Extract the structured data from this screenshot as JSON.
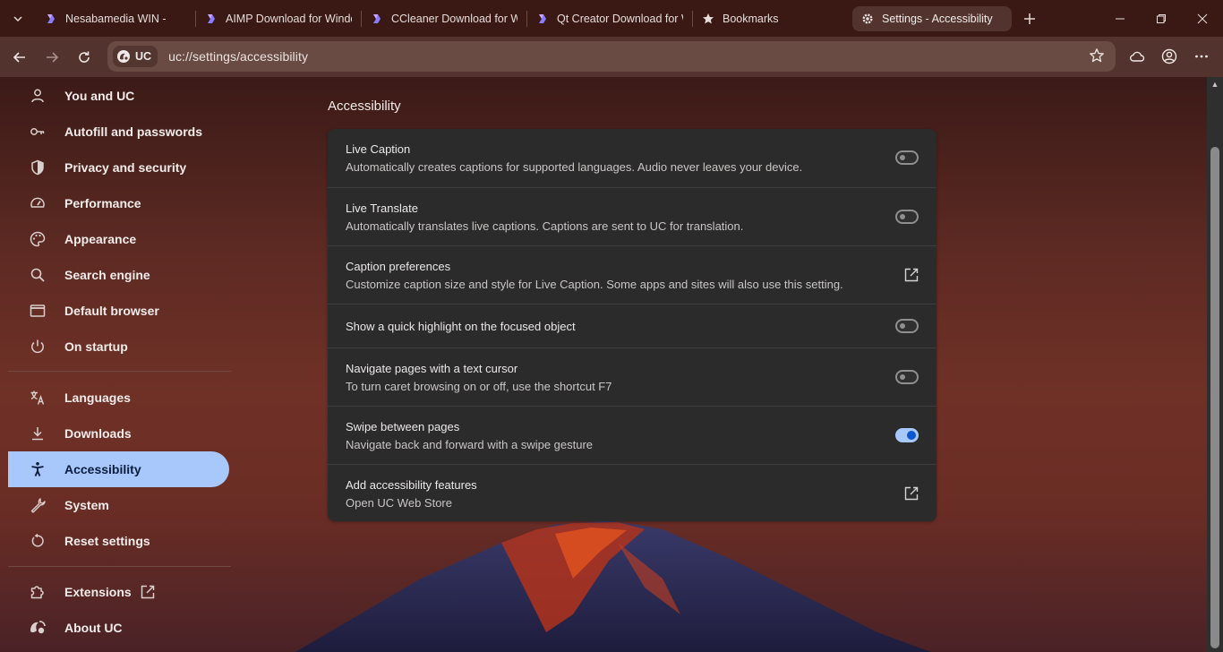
{
  "tabs": [
    {
      "title": "Nesabamedia WIN -",
      "favicon": "uc-favicon"
    },
    {
      "title": "AIMP Download for Windows",
      "favicon": "uc-favicon"
    },
    {
      "title": "CCleaner Download for Windows",
      "favicon": "uc-favicon"
    },
    {
      "title": "Qt Creator Download for Windows",
      "favicon": "uc-favicon"
    },
    {
      "title": "Bookmarks",
      "favicon": "star-icon"
    },
    {
      "title": "Settings - Accessibility",
      "favicon": "gear-icon",
      "active": true
    }
  ],
  "omnibox": {
    "chip": "UC",
    "url": "uc://settings/accessibility"
  },
  "sidebar": {
    "items": [
      {
        "label": "You and UC",
        "icon": "person-icon"
      },
      {
        "label": "Autofill and passwords",
        "icon": "key-icon"
      },
      {
        "label": "Privacy and security",
        "icon": "shield-icon"
      },
      {
        "label": "Performance",
        "icon": "speedometer-icon"
      },
      {
        "label": "Appearance",
        "icon": "palette-icon"
      },
      {
        "label": "Search engine",
        "icon": "search-icon"
      },
      {
        "label": "Default browser",
        "icon": "browser-window-icon"
      },
      {
        "label": "On startup",
        "icon": "power-icon"
      },
      {
        "label": "Languages",
        "icon": "translate-icon"
      },
      {
        "label": "Downloads",
        "icon": "download-icon"
      },
      {
        "label": "Accessibility",
        "icon": "accessibility-icon",
        "selected": true
      },
      {
        "label": "System",
        "icon": "wrench-icon"
      },
      {
        "label": "Reset settings",
        "icon": "reset-icon"
      },
      {
        "label": "Extensions",
        "icon": "puzzle-icon"
      },
      {
        "label": "About UC",
        "icon": "uc-logo-icon"
      }
    ]
  },
  "main": {
    "section_title": "Accessibility",
    "rows": [
      {
        "title": "Live Caption",
        "subtitle": "Automatically creates captions for supported languages. Audio never leaves your device.",
        "control": "toggle",
        "on": false
      },
      {
        "title": "Live Translate",
        "subtitle": "Automatically translates live captions. Captions are sent to UC for translation.",
        "control": "toggle",
        "on": false
      },
      {
        "title": "Caption preferences",
        "subtitle": "Customize caption size and style for Live Caption. Some apps and sites will also use this setting.",
        "control": "external-link"
      },
      {
        "title": "Show a quick highlight on the focused object",
        "subtitle": "",
        "control": "toggle",
        "on": false
      },
      {
        "title": "Navigate pages with a text cursor",
        "subtitle": "To turn caret browsing on or off, use the shortcut F7",
        "control": "toggle",
        "on": false
      },
      {
        "title": "Swipe between pages",
        "subtitle": "Navigate back and forward with a swipe gesture",
        "control": "toggle",
        "on": true
      },
      {
        "title": "Add accessibility features",
        "subtitle": "Open UC Web Store",
        "control": "external-link"
      }
    ]
  },
  "colors": {
    "accent": "#a8c7fa",
    "toggle_on_knob": "#0b57d0",
    "card_bg": "#2b2b2c"
  }
}
